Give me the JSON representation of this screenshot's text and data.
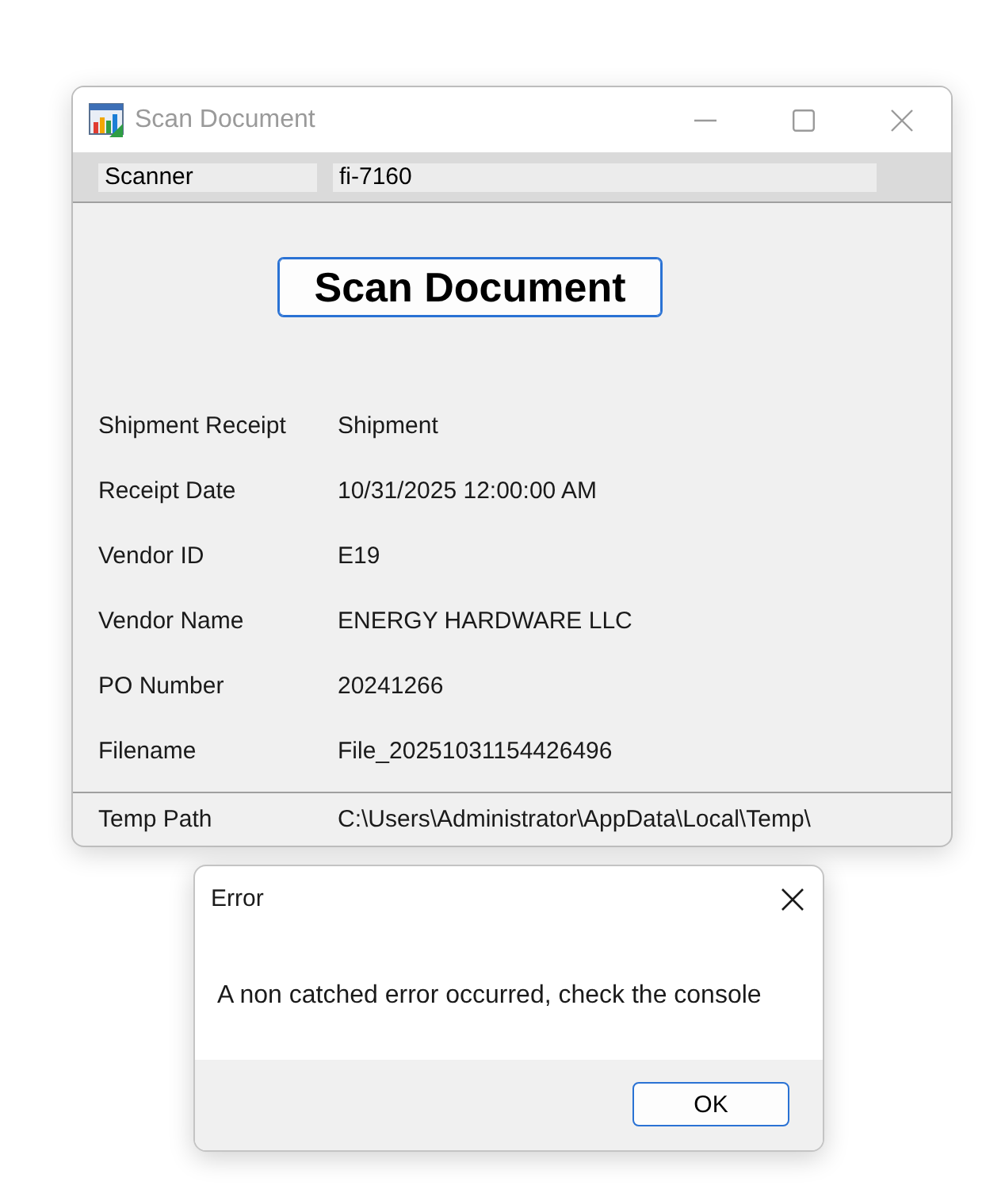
{
  "window": {
    "title": "Scan Document",
    "active": false
  },
  "scanner_bar": {
    "label": "Scanner",
    "value": "fi-7160"
  },
  "scan_button": {
    "label": "Scan Document",
    "default": true
  },
  "fields": [
    {
      "label": "Shipment Receipt",
      "value": "Shipment"
    },
    {
      "label": "Receipt Date",
      "value": "10/31/2025 12:00:00 AM"
    },
    {
      "label": "Vendor ID",
      "value": "E19"
    },
    {
      "label": "Vendor Name",
      "value": "ENERGY HARDWARE LLC"
    },
    {
      "label": "PO Number",
      "value": "20241266"
    },
    {
      "label": "Filename",
      "value": "File_20251031154426496"
    }
  ],
  "status_row": {
    "label": "Temp Path",
    "value": "C:\\Users\\Administrator\\AppData\\Local\\Temp\\"
  },
  "dialog": {
    "title": "Error",
    "message": "A non catched error occurred, check the console",
    "buttons": [
      {
        "label": "OK",
        "default": true
      }
    ]
  }
}
